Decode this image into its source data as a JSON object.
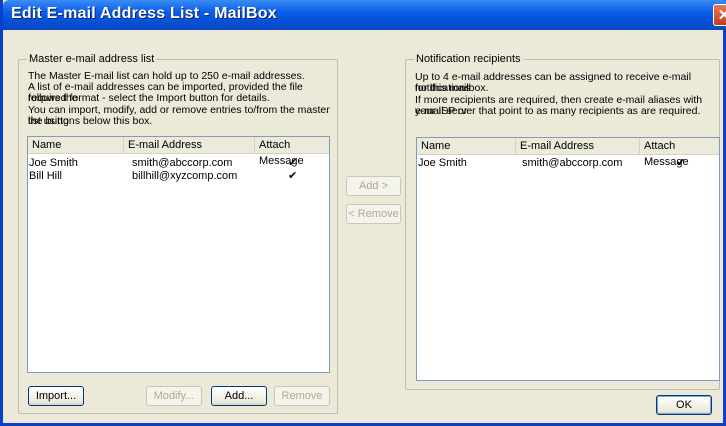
{
  "window": {
    "title": "Edit E-mail Address List - MailBox"
  },
  "master": {
    "group_title": "Master e-mail address list",
    "desc1": "The Master E-mail list can hold up to 250 e-mail addresses.",
    "desc2a": "A list of e-mail addresses can be imported, provided the file follows the",
    "desc2b": "required format - select the Import button for details.",
    "desc3a": "You can import, modify, add or remove entries to/from the master list using",
    "desc3b": "the buttons below this box.",
    "columns": [
      "Name",
      "E-mail Address",
      "Attach Message"
    ],
    "rows": [
      {
        "name": "Joe Smith",
        "email": "smith@abccorp.com",
        "attach": "✔"
      },
      {
        "name": "Bill Hill",
        "email": "billhill@xyzcomp.com",
        "attach": "✔"
      }
    ],
    "buttons": {
      "import": "Import...",
      "modify": "Modify...",
      "add": "Add...",
      "remove": "Remove"
    }
  },
  "middle": {
    "add_label": "Add >",
    "remove_label": "< Remove"
  },
  "notify": {
    "group_title": "Notification recipients",
    "desc1a": "Up to 4 e-mail addresses can be assigned to receive e-mail notifications",
    "desc1b": "for this mailbox.",
    "desc2a": "If more recipients are required, then create e-mail aliases with your ISP or",
    "desc2b": "e-mail server that point to as many recipients as are required.",
    "columns": [
      "Name",
      "E-mail Address",
      "Attach Message"
    ],
    "rows": [
      {
        "name": "Joe Smith",
        "email": "smith@abccorp.com",
        "attach": "✔"
      }
    ]
  },
  "footer": {
    "ok_label": "OK"
  }
}
